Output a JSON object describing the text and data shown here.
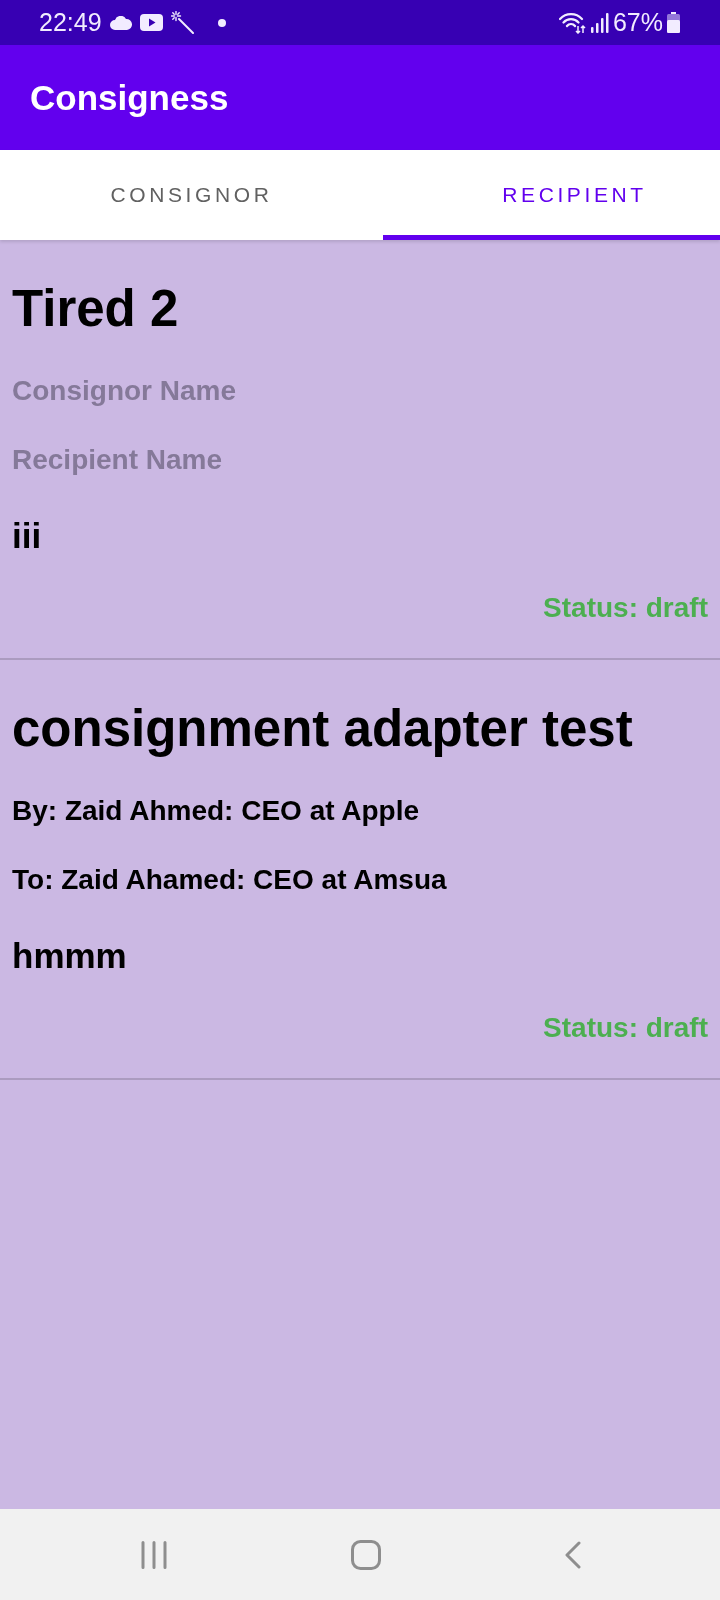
{
  "status_bar": {
    "time": "22:49",
    "battery": "67%"
  },
  "app_bar": {
    "title": "Consigness"
  },
  "tabs": [
    {
      "label": "CONSIGNOR",
      "selected": false
    },
    {
      "label": "RECIPIENT",
      "selected": true
    }
  ],
  "consignments": [
    {
      "title": "Tired 2",
      "consignor": {
        "text": "Consignor Name",
        "hint": true
      },
      "recipient": {
        "text": "Recipient Name",
        "hint": true
      },
      "description": "iii",
      "status": "Status: draft"
    },
    {
      "title": "consignment adapter test",
      "consignor": {
        "text": "By: Zaid Ahmed: CEO at Apple",
        "hint": false
      },
      "recipient": {
        "text": "To: Zaid Ahamed: CEO at Amsua",
        "hint": false
      },
      "description": "hmmm",
      "status": "Status: draft"
    }
  ]
}
